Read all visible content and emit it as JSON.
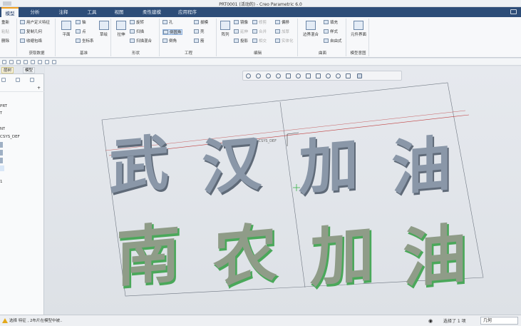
{
  "window": {
    "title": "PRT0001 (活动的) - Creo Parametric 6.0"
  },
  "ribbon_tabs": [
    "模型",
    "分析",
    "注释",
    "工具",
    "视图",
    "柔性建模",
    "应用程序"
  ],
  "ribbon": {
    "groups": [
      {
        "title": "",
        "items": [
          "重新",
          "粘贴",
          "删除"
        ]
      },
      {
        "title": "获取数据",
        "items": [
          "用户定义特征",
          "复制几何",
          "收缩包络"
        ]
      },
      {
        "title": "基准",
        "items": [
          "轴",
          "点",
          "坐标系"
        ],
        "big": [
          "平面",
          "草绘"
        ]
      },
      {
        "title": "形状",
        "items": [
          "旋转",
          "扫描",
          "扫描混合"
        ],
        "big": [
          "拉伸"
        ]
      },
      {
        "title": "工程",
        "items": [
          "孔",
          "倒圆角",
          "倒角",
          "拔模",
          "壳",
          "筋"
        ]
      },
      {
        "title": "编辑",
        "items": [
          "阵列",
          "镜像",
          "延伸",
          "投影",
          "修剪",
          "合并",
          "相交",
          "偏移",
          "加厚",
          "实体化"
        ]
      },
      {
        "title": "曲面",
        "items": [
          "边界混合",
          "填充",
          "样式",
          "自由式"
        ]
      },
      {
        "title": "模型意图",
        "items": [
          "元件界面"
        ]
      }
    ]
  },
  "left_panel": {
    "tabs": [
      "层树",
      "模型"
    ],
    "tree": [
      "PRT",
      "T",
      "",
      "NT",
      "CSYS_DEF",
      "",
      "",
      "",
      "",
      "",
      "1"
    ]
  },
  "viewport": {
    "labels": {
      "axis": "PRT_CSYS_DEF"
    },
    "text_top": [
      "武",
      "汉",
      "加",
      "油"
    ],
    "text_bottom": [
      "南",
      "农",
      "加",
      "油"
    ],
    "colors": {
      "extrude_top": "#8a97a8",
      "extrude_bottom": "#7f8b77",
      "edge_green": "#4aa85a",
      "datum_red": "#c04040"
    }
  },
  "status": {
    "message": "选择 特征 , 2布片在模型中被..",
    "selected": "选择了 1 项",
    "filter": "几何"
  },
  "icons": [
    "search-icon",
    "zoom-in-icon",
    "zoom-out-icon",
    "refit-icon",
    "repaint-icon",
    "view-icon",
    "filter-icon",
    "warning-icon",
    "binoculars-icon"
  ]
}
